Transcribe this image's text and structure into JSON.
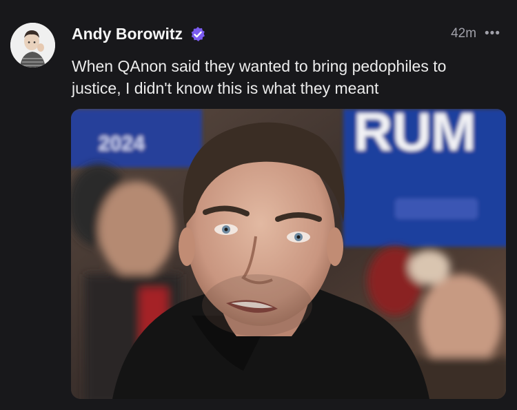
{
  "post": {
    "author": {
      "name": "Andy Borowitz",
      "verified": true,
      "avatar": "avatar"
    },
    "timestamp": "42m",
    "more_icon": "more-horizontal-icon",
    "text": "When QAnon said they wanted to bring pedophiles to justice, I didn't know this is what they meant",
    "media": {
      "sign_text": "RUM",
      "sign_small": "2024",
      "colors": {
        "sign_blue": "#1f3f9e",
        "background_red": "#8f1c22",
        "jacket": "#141414"
      }
    }
  },
  "colors": {
    "background": "#18181b",
    "verified_badge": "#7b5cf0",
    "muted": "#a1a1aa"
  }
}
